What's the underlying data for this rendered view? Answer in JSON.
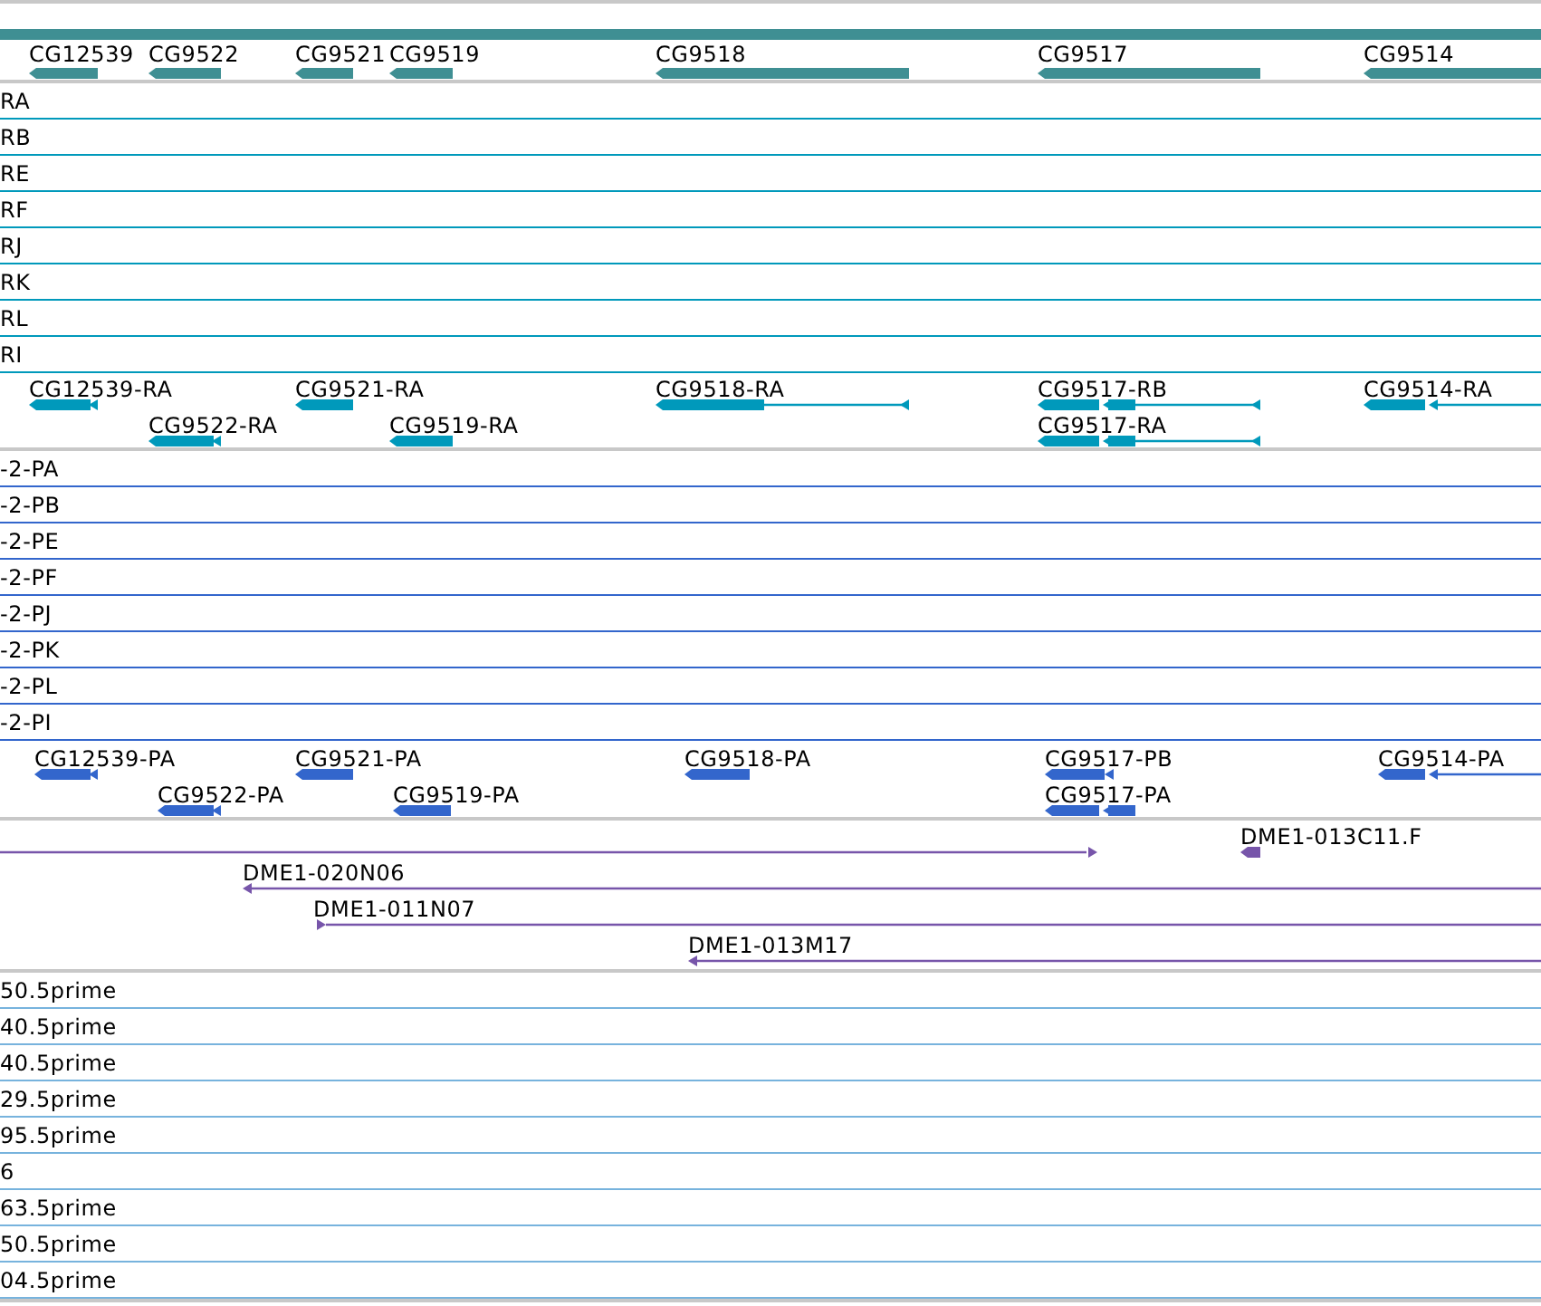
{
  "gene_track": {
    "genes": [
      {
        "label": "CG12539"
      },
      {
        "label": "CG9522"
      },
      {
        "label": "CG9521"
      },
      {
        "label": "CG9519"
      },
      {
        "label": "CG9518"
      },
      {
        "label": "CG9517"
      },
      {
        "label": "CG9514"
      }
    ]
  },
  "transcript_rows": [
    {
      "label": "RA"
    },
    {
      "label": "RB"
    },
    {
      "label": "RE"
    },
    {
      "label": "RF"
    },
    {
      "label": "RJ"
    },
    {
      "label": "RK"
    },
    {
      "label": "RL"
    },
    {
      "label": "RI"
    }
  ],
  "transcript_track": {
    "transcripts": [
      {
        "label": "CG12539-RA"
      },
      {
        "label": "CG9522-RA"
      },
      {
        "label": "CG9521-RA"
      },
      {
        "label": "CG9519-RA"
      },
      {
        "label": "CG9518-RA"
      },
      {
        "label": "CG9517-RB"
      },
      {
        "label": "CG9517-RA"
      },
      {
        "label": "CG9514-RA"
      }
    ]
  },
  "protein_rows": [
    {
      "label": "-2-PA"
    },
    {
      "label": "-2-PB"
    },
    {
      "label": "-2-PE"
    },
    {
      "label": "-2-PF"
    },
    {
      "label": "-2-PJ"
    },
    {
      "label": "-2-PK"
    },
    {
      "label": "-2-PL"
    },
    {
      "label": "-2-PI"
    }
  ],
  "protein_track": {
    "proteins": [
      {
        "label": "CG12539-PA"
      },
      {
        "label": "CG9522-PA"
      },
      {
        "label": "CG9521-PA"
      },
      {
        "label": "CG9519-PA"
      },
      {
        "label": "CG9518-PA"
      },
      {
        "label": "CG9517-PB"
      },
      {
        "label": "CG9517-PA"
      },
      {
        "label": "CG9514-PA"
      }
    ]
  },
  "clone_track": {
    "clones": [
      {
        "label": "DME1-013C11.F"
      },
      {
        "label": "DME1-020N06"
      },
      {
        "label": "DME1-011N07"
      },
      {
        "label": "DME1-013M17"
      }
    ]
  },
  "est_rows": [
    {
      "label": "50.5prime"
    },
    {
      "label": "40.5prime"
    },
    {
      "label": "40.5prime"
    },
    {
      "label": "29.5prime"
    },
    {
      "label": "95.5prime"
    },
    {
      "label": "6"
    },
    {
      "label": "63.5prime"
    },
    {
      "label": "50.5prime"
    },
    {
      "label": "04.5prime"
    }
  ]
}
